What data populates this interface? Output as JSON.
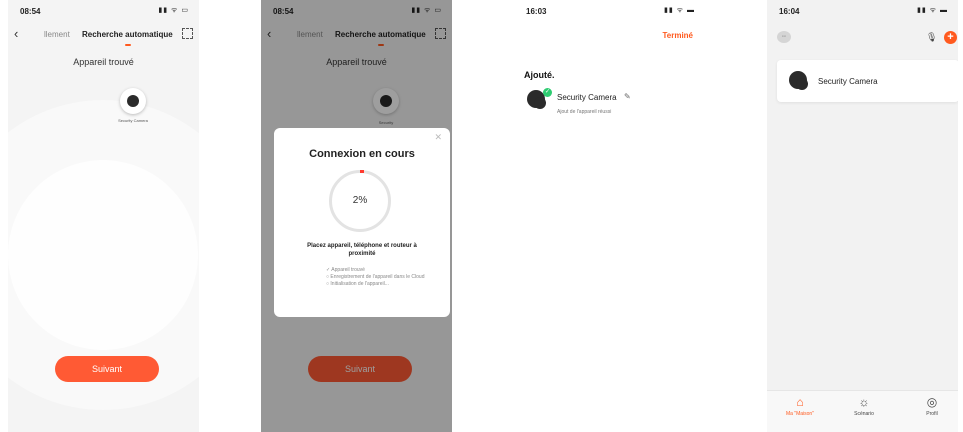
{
  "screen1": {
    "time": "08:54",
    "status_icons": "▮▮ ᯤ ▭",
    "tab_left": "llement",
    "tab_active": "Recherche automatique",
    "title": "Appareil trouvé",
    "device_label": "Security Camera",
    "next_button": "Suivant"
  },
  "screen2": {
    "time": "08:54",
    "status_icons": "▮▮ ᯤ ▭",
    "tab_left": "llement",
    "tab_active": "Recherche automatique",
    "title": "Appareil trouvé",
    "device_label": "Security",
    "dialog_title": "Connexion en cours",
    "progress_text": "2%",
    "progress_value": 2,
    "message": "Placez appareil, téléphone et routeur à proximité",
    "steps": [
      "✓ Appareil trouvé",
      "○ Enregistrement de l'appareil dans le Cloud",
      "○ Initialisation de l'appareil..."
    ],
    "next_button": "Suivant"
  },
  "screen3": {
    "time": "16:03",
    "status_icons": "▮▮ ᯤ ▬",
    "done_label": "Terminé",
    "section_title": "Ajouté.",
    "device_name": "Security Camera",
    "device_status": "Ajout de l'appareil réussi"
  },
  "screen4": {
    "time": "16:04",
    "status_icons": "▮▮ ᯤ ▬",
    "card_device": "Security Camera",
    "tabs": [
      {
        "label": "Ma \"Maison\"",
        "icon": "home-icon"
      },
      {
        "label": "Scénario",
        "icon": "sun-icon"
      },
      {
        "label": "Profil",
        "icon": "profile-icon"
      }
    ]
  },
  "colors": {
    "accent": "#ff5a1f",
    "success": "#2ecc71"
  }
}
